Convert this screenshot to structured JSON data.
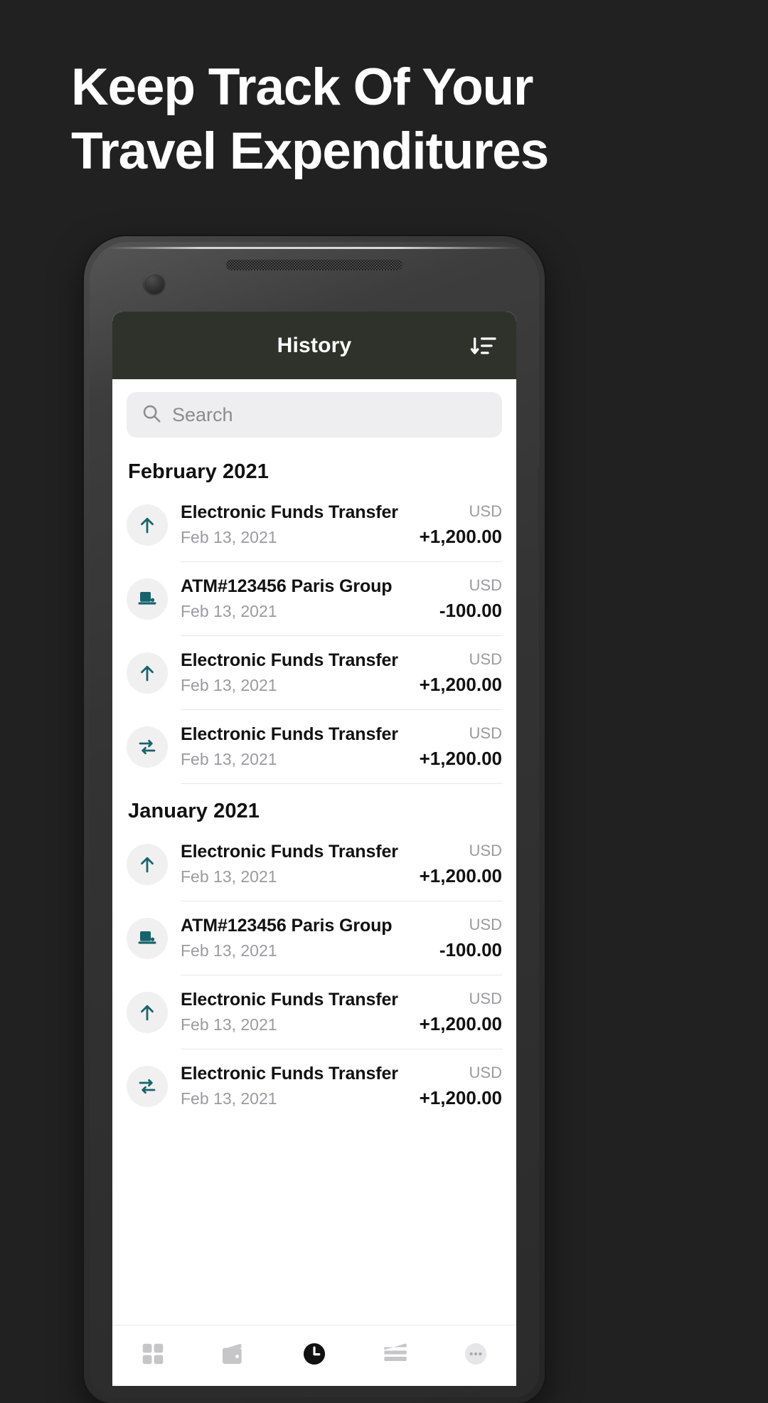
{
  "promo": {
    "headline_line1": "Keep Track Of Your",
    "headline_line2": "Travel Expenditures",
    "background_color": "#212121",
    "text_color": "#ffffff"
  },
  "app": {
    "header": {
      "title": "History",
      "sort_icon": "sort-descending-icon",
      "background_color": "#2e322b"
    },
    "search": {
      "placeholder": "Search",
      "icon": "search-icon",
      "value": ""
    },
    "accent_color": "#14656b",
    "groups": [
      {
        "month_label": "February 2021",
        "transactions": [
          {
            "icon": "arrow-up-icon",
            "title": "Electronic Funds Transfer",
            "date": "Feb 13, 2021",
            "currency": "USD",
            "amount": "+1,200.00"
          },
          {
            "icon": "atm-icon",
            "title": "ATM#123456 Paris Group",
            "date": "Feb 13, 2021",
            "currency": "USD",
            "amount": "-100.00"
          },
          {
            "icon": "arrow-up-icon",
            "title": "Electronic Funds Transfer",
            "date": "Feb 13, 2021",
            "currency": "USD",
            "amount": "+1,200.00"
          },
          {
            "icon": "exchange-icon",
            "title": "Electronic Funds Transfer",
            "date": "Feb 13, 2021",
            "currency": "USD",
            "amount": "+1,200.00"
          }
        ]
      },
      {
        "month_label": "January 2021",
        "transactions": [
          {
            "icon": "arrow-up-icon",
            "title": "Electronic Funds Transfer",
            "date": "Feb 13, 2021",
            "currency": "USD",
            "amount": "+1,200.00"
          },
          {
            "icon": "atm-icon",
            "title": "ATM#123456 Paris Group",
            "date": "Feb 13, 2021",
            "currency": "USD",
            "amount": "-100.00"
          },
          {
            "icon": "arrow-up-icon",
            "title": "Electronic Funds Transfer",
            "date": "Feb 13, 2021",
            "currency": "USD",
            "amount": "+1,200.00"
          },
          {
            "icon": "exchange-icon",
            "title": "Electronic Funds Transfer",
            "date": "Feb 13, 2021",
            "currency": "USD",
            "amount": "+1,200.00"
          }
        ]
      }
    ],
    "bottom_nav": [
      {
        "icon": "grid-dashboard-icon",
        "active": false
      },
      {
        "icon": "wallet-icon",
        "active": false
      },
      {
        "icon": "clock-history-icon",
        "active": true
      },
      {
        "icon": "card-icon",
        "active": false
      },
      {
        "icon": "more-dots-icon",
        "active": false
      }
    ]
  }
}
